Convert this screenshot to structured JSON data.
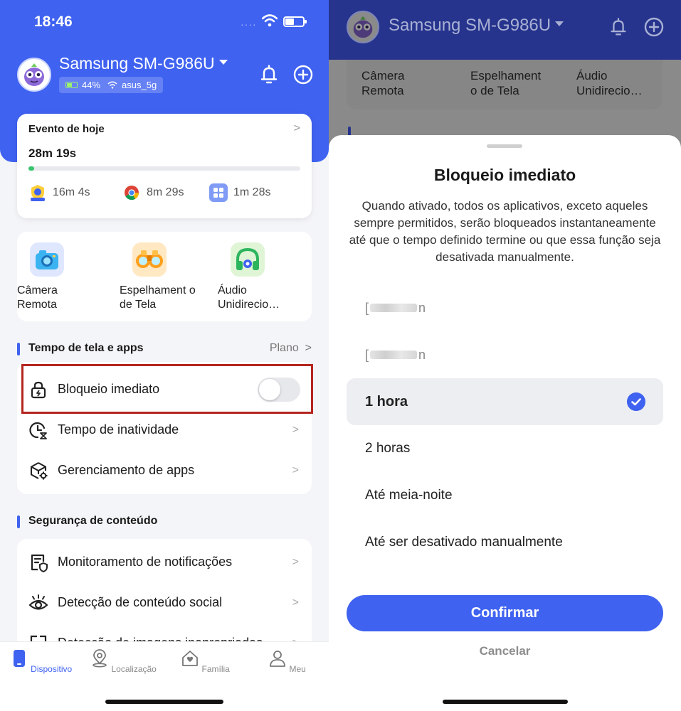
{
  "left": {
    "status_bar": {
      "time": "18:46",
      "signal": "····"
    },
    "header": {
      "device_name": "Samsung SM-G986U",
      "battery_text": "44%",
      "battery_level": 0.44,
      "wifi_name": "asus_5g"
    },
    "event_card": {
      "title": "Evento de hoje",
      "total_time": "28m 19s",
      "progress": 0.02,
      "apps": [
        {
          "name": "kids-app",
          "time": "16m 4s"
        },
        {
          "name": "chrome",
          "time": "8m 29s"
        },
        {
          "name": "apps-grid",
          "time": "1m 28s"
        }
      ]
    },
    "features": [
      {
        "label": "Câmera Remota",
        "icon": "camera-icon"
      },
      {
        "label": "Espelhament o de Tela",
        "icon": "binoculars-icon"
      },
      {
        "label": "Áudio Unidirecio…",
        "icon": "headphones-icon"
      }
    ],
    "screen_time_section": {
      "title": "Tempo de tela e apps",
      "link": "Plano",
      "items": [
        {
          "label": "Bloqueio imediato",
          "icon": "lock-icon",
          "toggle_on": false
        },
        {
          "label": "Tempo de inatividade",
          "icon": "clock-icon"
        },
        {
          "label": "Gerenciamento de apps",
          "icon": "app-manage-icon"
        }
      ]
    },
    "content_section": {
      "title": "Segurança de conteúdo",
      "items": [
        {
          "label": "Monitoramento de notificações",
          "icon": "notification-monitor-icon"
        },
        {
          "label": "Detecção de conteúdo social",
          "icon": "eye-icon"
        },
        {
          "label": "Detecção de imagens inapropriadas",
          "icon": "image-detect-icon"
        }
      ]
    },
    "tabbar": [
      {
        "label": "Dispositivo",
        "icon": "device-icon",
        "active": true
      },
      {
        "label": "Localização",
        "icon": "location-icon",
        "active": false
      },
      {
        "label": "Família",
        "icon": "family-icon",
        "active": false
      },
      {
        "label": "Meu",
        "icon": "profile-icon",
        "active": false
      }
    ]
  },
  "right": {
    "header": {
      "device_name": "Samsung SM-G986U"
    },
    "behind_features": [
      "Câmera Remota",
      "Espelhament o de Tela",
      "Áudio Unidirecio…"
    ],
    "sheet": {
      "title": "Bloqueio imediato",
      "description": "Quando ativado, todos os aplicativos, exceto aqueles sempre permitidos, serão bloqueados instantaneamente até que o tempo definido termine ou que essa função seja desativada manualmente.",
      "options": [
        {
          "label": "[",
          "suffix": "n",
          "obscured": true
        },
        {
          "label": "[",
          "suffix": "n",
          "obscured": true
        },
        {
          "label": "1 hora",
          "selected": true
        },
        {
          "label": "2 horas"
        },
        {
          "label": "Até meia-noite"
        },
        {
          "label": "Até ser desativado manualmente"
        }
      ],
      "confirm_label": "Confirmar",
      "cancel_label": "Cancelar"
    }
  },
  "colors": {
    "accent": "#3f62f0",
    "highlight_border": "#b4251f",
    "progress_green": "#35c46b"
  }
}
